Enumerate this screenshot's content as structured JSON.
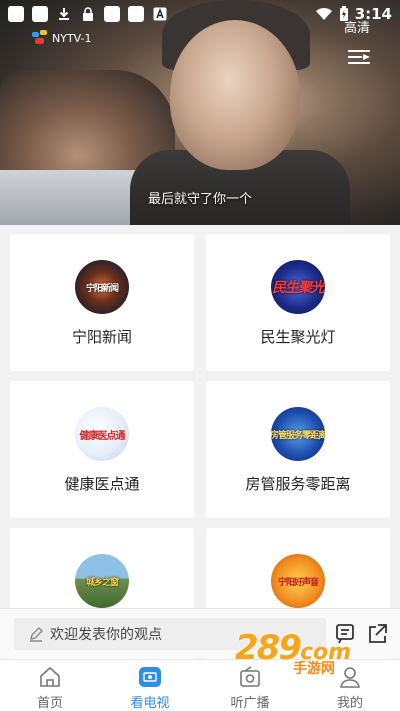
{
  "status_bar": {
    "time": "3:14",
    "icons": [
      "square",
      "square",
      "download-icon",
      "lock-icon",
      "square",
      "square",
      "a-icon",
      "wifi-icon",
      "battery-icon"
    ]
  },
  "player": {
    "channel_name": "NYTV-1",
    "quality": "高清",
    "subtitle": "最后就守了你一个"
  },
  "programs": [
    {
      "label": "宁阳新闻",
      "thumb_text": "宁阳新闻"
    },
    {
      "label": "民生聚光灯",
      "thumb_text": "民生聚光"
    },
    {
      "label": "健康医点通",
      "thumb_text": "健康医点通"
    },
    {
      "label": "房管服务零距离",
      "thumb_text": "房管服务零距离"
    },
    {
      "label": "",
      "thumb_text": "城乡之窗"
    },
    {
      "label": "",
      "thumb_text": "宁阳好声音"
    }
  ],
  "comment": {
    "placeholder": "欢迎发表你的观点"
  },
  "bottom_nav": [
    {
      "label": "首页",
      "icon": "home-icon",
      "active": false
    },
    {
      "label": "看电视",
      "icon": "tv-icon",
      "active": true
    },
    {
      "label": "听广播",
      "icon": "radio-icon",
      "active": false
    },
    {
      "label": "我的",
      "icon": "user-icon",
      "active": false
    }
  ],
  "watermark": {
    "number": "289",
    "suffix": "com",
    "sub": "手游网"
  },
  "colors": {
    "accent": "#2f8de4",
    "watermark": "#f7a61c"
  }
}
